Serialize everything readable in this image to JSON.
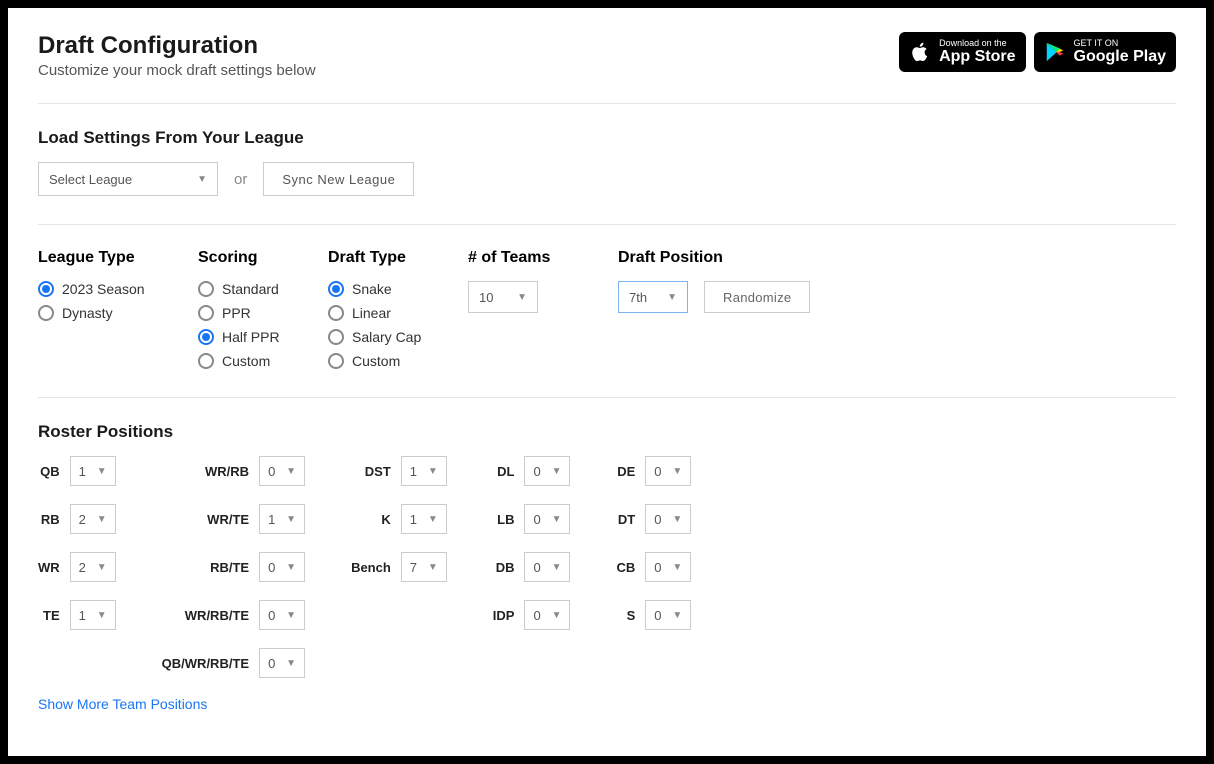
{
  "header": {
    "title": "Draft Configuration",
    "subtitle": "Customize your mock draft settings below"
  },
  "badges": {
    "appstore_small": "Download on the",
    "appstore_big": "App Store",
    "play_small": "GET IT ON",
    "play_big": "Google Play"
  },
  "load": {
    "title": "Load Settings From Your League",
    "select_placeholder": "Select League",
    "or": "or",
    "sync_button": "Sync New League"
  },
  "league_type": {
    "title": "League Type",
    "options": [
      "2023 Season",
      "Dynasty"
    ],
    "selected": "2023 Season"
  },
  "scoring": {
    "title": "Scoring",
    "options": [
      "Standard",
      "PPR",
      "Half PPR",
      "Custom"
    ],
    "selected": "Half PPR"
  },
  "draft_type": {
    "title": "Draft Type",
    "options": [
      "Snake",
      "Linear",
      "Salary Cap",
      "Custom"
    ],
    "selected": "Snake"
  },
  "num_teams": {
    "title": "# of Teams",
    "value": "10"
  },
  "draft_position": {
    "title": "Draft Position",
    "value": "7th",
    "randomize": "Randomize"
  },
  "roster": {
    "title": "Roster Positions",
    "cols": [
      [
        {
          "label": "QB",
          "value": "1"
        },
        {
          "label": "RB",
          "value": "2"
        },
        {
          "label": "WR",
          "value": "2"
        },
        {
          "label": "TE",
          "value": "1"
        }
      ],
      [
        {
          "label": "WR/RB",
          "value": "0"
        },
        {
          "label": "WR/TE",
          "value": "1"
        },
        {
          "label": "RB/TE",
          "value": "0"
        },
        {
          "label": "WR/RB/TE",
          "value": "0"
        },
        {
          "label": "QB/WR/RB/TE",
          "value": "0"
        }
      ],
      [
        {
          "label": "DST",
          "value": "1"
        },
        {
          "label": "K",
          "value": "1"
        },
        {
          "label": "Bench",
          "value": "7"
        }
      ],
      [
        {
          "label": "DL",
          "value": "0"
        },
        {
          "label": "LB",
          "value": "0"
        },
        {
          "label": "DB",
          "value": "0"
        },
        {
          "label": "IDP",
          "value": "0"
        }
      ],
      [
        {
          "label": "DE",
          "value": "0"
        },
        {
          "label": "DT",
          "value": "0"
        },
        {
          "label": "CB",
          "value": "0"
        },
        {
          "label": "S",
          "value": "0"
        }
      ]
    ],
    "show_more": "Show More Team Positions"
  }
}
